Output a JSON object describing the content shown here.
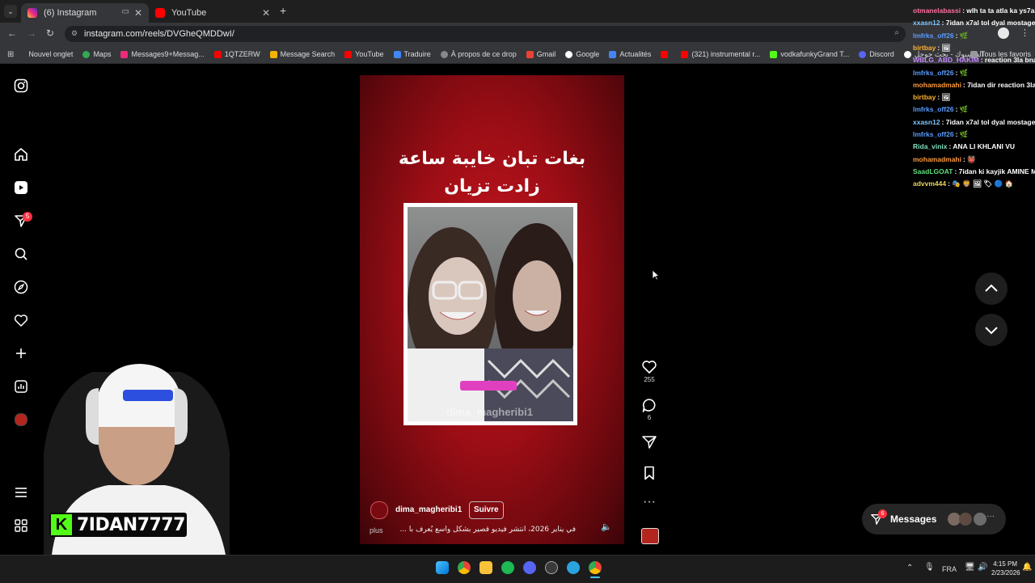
{
  "browser": {
    "tabs": [
      {
        "label": "(6) Instagram",
        "active": true
      },
      {
        "label": "YouTube",
        "active": false
      }
    ],
    "url": "instagram.com/reels/DVGheQMDDwI/",
    "bookmarks": [
      "Nouvel onglet",
      "Maps",
      "Messages9+Messag...",
      "1QTZERW",
      "Message Search",
      "YouTube",
      "Traduire",
      "À propos de ce drop",
      "Gmail",
      "Google",
      "Actualités",
      "(321) instrumental r...",
      "vodkafunkyGrand T...",
      "Discord",
      "الفيسبوك - بحث جوجل"
    ],
    "all_favorites": "Tous les favoris"
  },
  "sidebar": {
    "items": [
      "instagram-logo-icon",
      "home-icon",
      "reels-icon",
      "messages-icon",
      "search-icon",
      "explore-icon",
      "notifications-icon",
      "create-icon",
      "dashboard-icon",
      "profile-avatar",
      "menu-icon",
      "more-apps-icon"
    ],
    "messages_badge": "5"
  },
  "reel": {
    "caption_line1": "بغات تبان خايبة ساعة",
    "caption_line2": "زادت تزيان",
    "watermark": "dima_magheribi1",
    "likes": "255",
    "comments": "6",
    "username": "dima_magheribi1",
    "follow_label": "Suivre",
    "description": "في يناير 2026، انتشر فيديو قصير بشكل واسع يُعرف با ...",
    "more_label": "plus"
  },
  "messages_bar": {
    "label": "Messages",
    "badge": "6"
  },
  "streamer": {
    "name": "7IDAN7777"
  },
  "chat": [
    {
      "user": "otmanelabassi",
      "text": ": wlh ta ta atla ka ys7abli",
      "color": "#ff6fa0"
    },
    {
      "user": "xxasn12",
      "text": ": 7idan x7al tol dyal mostage dy",
      "color": "#7ec8ff"
    },
    {
      "user": "lmfrks_off26",
      "text": ": 🌿",
      "color": "#5a9cff"
    },
    {
      "user": "birtbay",
      "text": ": 🖼",
      "color": "#ffb030"
    },
    {
      "user": "WBLG_ABD_HAKIM",
      "text": ": reaction 3la bnat l",
      "color": "#c78cff"
    },
    {
      "user": "lmfrks_off26",
      "text": ": 🌿",
      "color": "#5a9cff"
    },
    {
      "user": "mohamadmahi",
      "text": ": 7idan dir reaction 3la 7",
      "color": "#ff9a3c"
    },
    {
      "user": "birtbay",
      "text": ": 🖼",
      "color": "#ffb030"
    },
    {
      "user": "lmfrks_off26",
      "text": ": 🌿",
      "color": "#5a9cff"
    },
    {
      "user": "xxasn12",
      "text": ": 7idan x7al tol dyal mostage dy",
      "color": "#7ec8ff"
    },
    {
      "user": "lmfrks_off26",
      "text": ": 🌿",
      "color": "#5a9cff"
    },
    {
      "user": "Rida_vinix",
      "text": ": ANA LI KHLANI VU",
      "color": "#7fe0c0"
    },
    {
      "user": "mohamadmahi",
      "text": ": 👹",
      "color": "#ff9a3c"
    },
    {
      "user": "SaadLGOAT",
      "text": ": 7idan ki kayjik AMINE MOL",
      "color": "#5ee07a"
    },
    {
      "user": "advvm444",
      "text": ": 🎭 🦁 🖼 🏷 🔵 🏠",
      "color": "#e8d25a"
    }
  ],
  "taskbar": {
    "lang": "FRA",
    "time": "4:15 PM",
    "date": "2/23/2026"
  }
}
